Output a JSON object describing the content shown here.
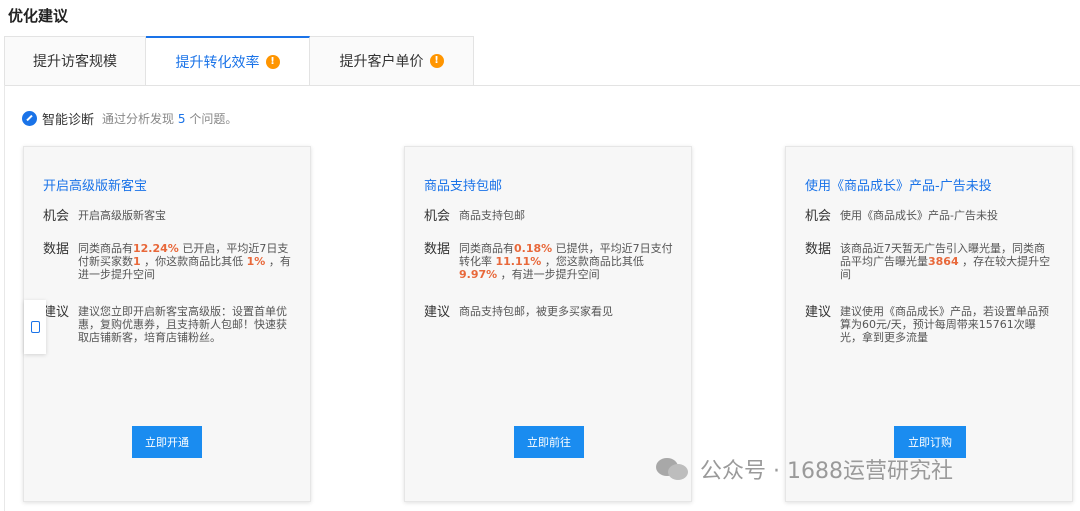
{
  "page_title": "优化建议",
  "tabs": [
    {
      "label": "提升访客规模",
      "warning": false
    },
    {
      "label": "提升转化效率",
      "warning": true
    },
    {
      "label": "提升客户单价",
      "warning": true
    }
  ],
  "warning_icon_glyph": "!",
  "diagnosis": {
    "label": "智能诊断",
    "text_prefix": "通过分析发现",
    "count": "5",
    "text_suffix": "个问题。"
  },
  "cards": [
    {
      "title": "开启高级版新客宝",
      "opportunity_label": "机会",
      "opportunity": "开启高级版新客宝",
      "data_label": "数据",
      "data_parts": [
        "同类商品有",
        "12.24%",
        "已开启，平均近7日支付新买家数",
        "1",
        "，你这款商品比其低",
        "1%",
        "，有进一步提升空间"
      ],
      "suggest_label": "建议",
      "suggestion": "建议您立即开启新客宝高级版：设置首单优惠，复购优惠券，且支持新人包邮！快速获取店铺新客，培育店铺粉丝。",
      "button": "立即开通"
    },
    {
      "title": "商品支持包邮",
      "opportunity_label": "机会",
      "opportunity": "商品支持包邮",
      "data_label": "数据",
      "data_parts": [
        "同类商品有",
        "0.18%",
        "已提供，平均近7日支付转化率",
        "11.11%",
        "，您这款商品比其低",
        "9.97%",
        "，有进一步提升空间"
      ],
      "suggest_label": "建议",
      "suggestion": "商品支持包邮，被更多买家看见",
      "button": "立即前往"
    },
    {
      "title": "使用《商品成长》产品-广告未投",
      "opportunity_label": "机会",
      "opportunity": "使用《商品成长》产品-广告未投",
      "data_label": "数据",
      "data_parts": [
        "该商品近7天暂无广告引入曝光量，同类商品平均广告曝光量",
        "3864",
        "，存在较大提升空间"
      ],
      "suggest_label": "建议",
      "suggestion": "建议使用《商品成长》产品，若设置单品预算为60元/天，预计每周带来15761次曝光，拿到更多流量",
      "button": "立即订购"
    }
  ],
  "watermark": "公众号 · 1688运营研究社",
  "colors": {
    "accent": "#1a73e8",
    "highlight": "#e8683a",
    "warning": "#ff9500",
    "button": "#1a8cf0"
  }
}
